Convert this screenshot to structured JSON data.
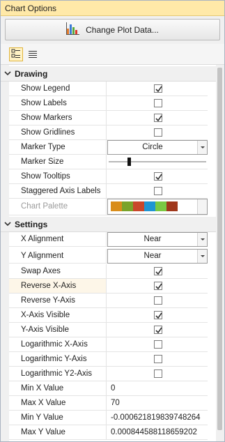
{
  "panel": {
    "title": "Chart Options"
  },
  "top": {
    "change_plot_label": "Change Plot Data..."
  },
  "sections": {
    "drawing": "Drawing",
    "settings": "Settings"
  },
  "drawing_rows": {
    "show_legend": {
      "label": "Show Legend",
      "checked": true
    },
    "show_labels": {
      "label": "Show Labels",
      "checked": false
    },
    "show_markers": {
      "label": "Show Markers",
      "checked": true
    },
    "show_gridlines": {
      "label": "Show Gridlines",
      "checked": false
    },
    "marker_type": {
      "label": "Marker Type",
      "value": "Circle"
    },
    "marker_size": {
      "label": "Marker Size",
      "level": 0.2
    },
    "show_tooltips": {
      "label": "Show Tooltips",
      "checked": true
    },
    "staggered_axis_labels": {
      "label": "Staggered Axis Labels",
      "checked": false
    },
    "chart_palette": {
      "label": "Chart Palette",
      "colors": [
        "#d98d1a",
        "#79a32a",
        "#c9472a",
        "#1f95d3",
        "#7ac943",
        "#a0371b"
      ]
    }
  },
  "settings_rows": {
    "x_alignment": {
      "label": "X Alignment",
      "value": "Near"
    },
    "y_alignment": {
      "label": "Y Alignment",
      "value": "Near"
    },
    "swap_axes": {
      "label": "Swap Axes",
      "checked": true
    },
    "reverse_x_axis": {
      "label": "Reverse X-Axis",
      "checked": true
    },
    "reverse_y_axis": {
      "label": "Reverse Y-Axis",
      "checked": false
    },
    "x_axis_visible": {
      "label": "X-Axis Visible",
      "checked": true
    },
    "y_axis_visible": {
      "label": "Y-Axis Visible",
      "checked": true
    },
    "log_x_axis": {
      "label": "Logarithmic X-Axis",
      "checked": false
    },
    "log_y_axis": {
      "label": "Logarithmic Y-Axis",
      "checked": false
    },
    "log_y2_axis": {
      "label": "Logarithmic Y2-Axis",
      "checked": false
    },
    "min_x_value": {
      "label": "Min X Value",
      "value": "0"
    },
    "max_x_value": {
      "label": "Max X Value",
      "value": "70"
    },
    "min_y_value": {
      "label": "Min Y Value",
      "value": "-0.000621819839748264"
    },
    "max_y_value": {
      "label": "Max Y Value",
      "value": "0.000844588118659202"
    }
  },
  "colors": {
    "title_bar": "#ffe9a8",
    "highlight_row": "#fdf6e8",
    "check_mark": "#333333"
  },
  "icons": {
    "change_plot": "bar-chart-icon",
    "categorized_view": "categorized-icon",
    "alphabetical_view": "alphabetical-list-icon",
    "section_toggle": "chevron-down-icon"
  }
}
